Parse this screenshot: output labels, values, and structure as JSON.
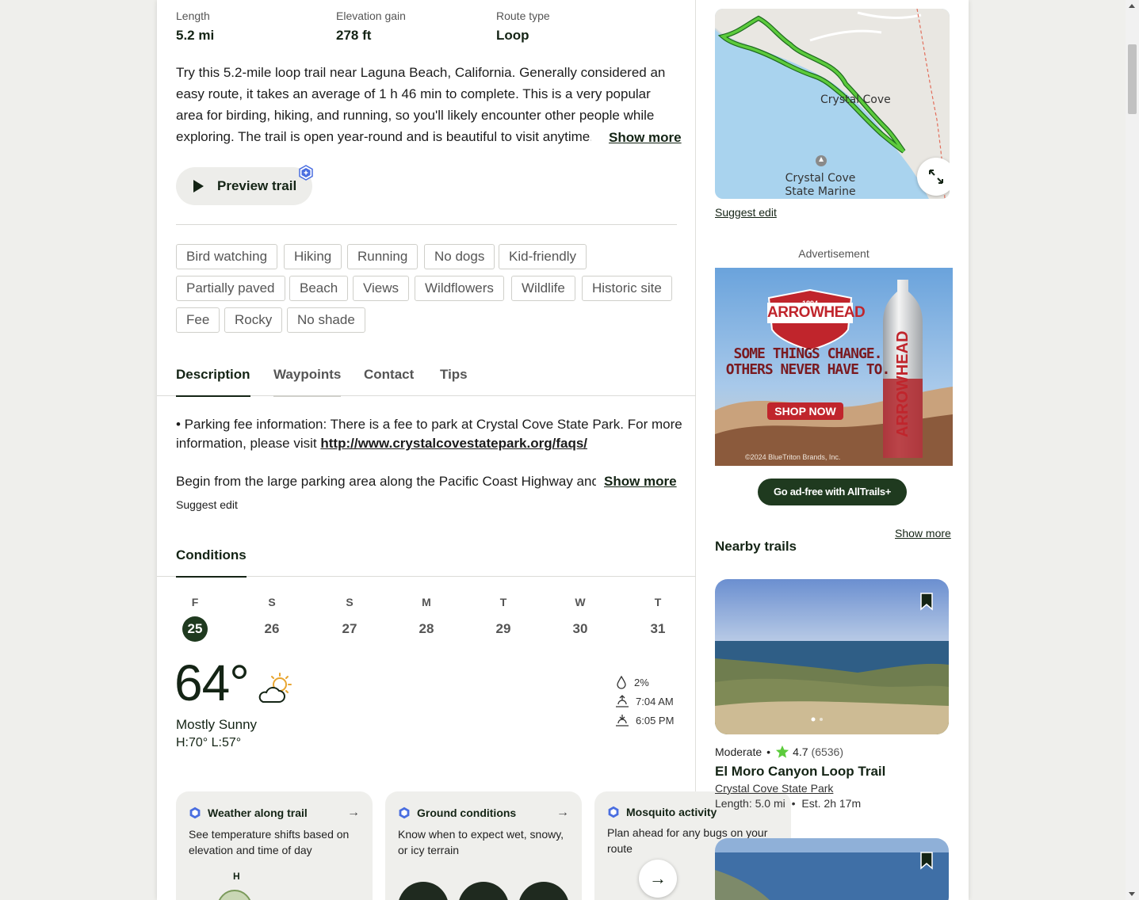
{
  "stats": [
    {
      "label": "Length",
      "value": "5.2 mi"
    },
    {
      "label": "Elevation gain",
      "value": "278 ft"
    },
    {
      "label": "Route type",
      "value": "Loop"
    }
  ],
  "description": {
    "text": "Try this 5.2-mile loop trail near Laguna Beach, California. Generally considered an easy route, it takes an average of 1 h 46 min to complete. This is a very popular area for birding, hiking, and running, so you'll likely encounter other people while exploring. The trail is open year-round and is beautiful to visit anytime. You'll need to leave pups at home",
    "show_more": "Show more"
  },
  "preview_button": "Preview trail",
  "tags": [
    "Bird watching",
    "Hiking",
    "Running",
    "No dogs",
    "Kid-friendly",
    "Partially paved",
    "Beach",
    "Views",
    "Wildflowers",
    "Wildlife",
    "Historic site",
    "Fee",
    "Rocky",
    "No shade"
  ],
  "tabs": [
    "Description",
    "Waypoints",
    "Contact",
    "Tips"
  ],
  "details": {
    "parking_prefix": "• Parking fee information: There is a fee to park at Crystal Cove State Park. For more information, please visit ",
    "parking_link": "http://www.crystalcovestatepark.org/faqs/",
    "begin_text": "Begin from the large parking area along the Pacific Coast Highway and proceed",
    "show_more": "Show more",
    "suggest_edit": "Suggest edit"
  },
  "conditions": {
    "tab": "Conditions",
    "days": [
      {
        "dow": "F",
        "num": "25",
        "selected": true
      },
      {
        "dow": "S",
        "num": "26"
      },
      {
        "dow": "S",
        "num": "27"
      },
      {
        "dow": "M",
        "num": "28"
      },
      {
        "dow": "T",
        "num": "29"
      },
      {
        "dow": "W",
        "num": "30"
      },
      {
        "dow": "T",
        "num": "31"
      }
    ],
    "temperature": "64°",
    "summary": "Mostly Sunny",
    "hilo": "H:70°  L:57°",
    "precip": "2%",
    "sunrise": "7:04 AM",
    "sunset": "6:05 PM"
  },
  "cards": [
    {
      "title": "Weather along trail",
      "body": "See temperature shifts based on elevation and time of day",
      "extra": "H"
    },
    {
      "title": "Ground conditions",
      "body": "Know when to expect wet, snowy, or icy terrain"
    },
    {
      "title": "Mosquito activity",
      "body": "Plan ahead for any bugs on your route"
    }
  ],
  "map": {
    "label1": "Crystal Cove",
    "label2": "Crystal Cove",
    "label3": "State Marine",
    "suggest_edit": "Suggest edit"
  },
  "ad": {
    "label": "Advertisement",
    "brand": "ARROWHEAD",
    "year": "1894",
    "tagline1": "SOME THINGS CHANGE.",
    "tagline2": "OTHERS NEVER HAVE TO.",
    "cta": "SHOP NOW",
    "copyright": "©2024 BlueTriton Brands, Inc.",
    "adfree": "Go ad-free with AllTrails+"
  },
  "nearby": {
    "title": "Nearby trails",
    "show_more": "Show more",
    "difficulty": "Moderate",
    "rating": "4.7",
    "reviews": "(6536)",
    "name": "El Moro Canyon Loop Trail",
    "park": "Crystal Cove State Park",
    "length": "Length: 5.0 mi",
    "est": "Est. 2h 17m"
  },
  "colors": {
    "accent": "#1f3a1f",
    "trail_line": "#5ccb3c",
    "plus_badge": "#4a6ee0"
  }
}
